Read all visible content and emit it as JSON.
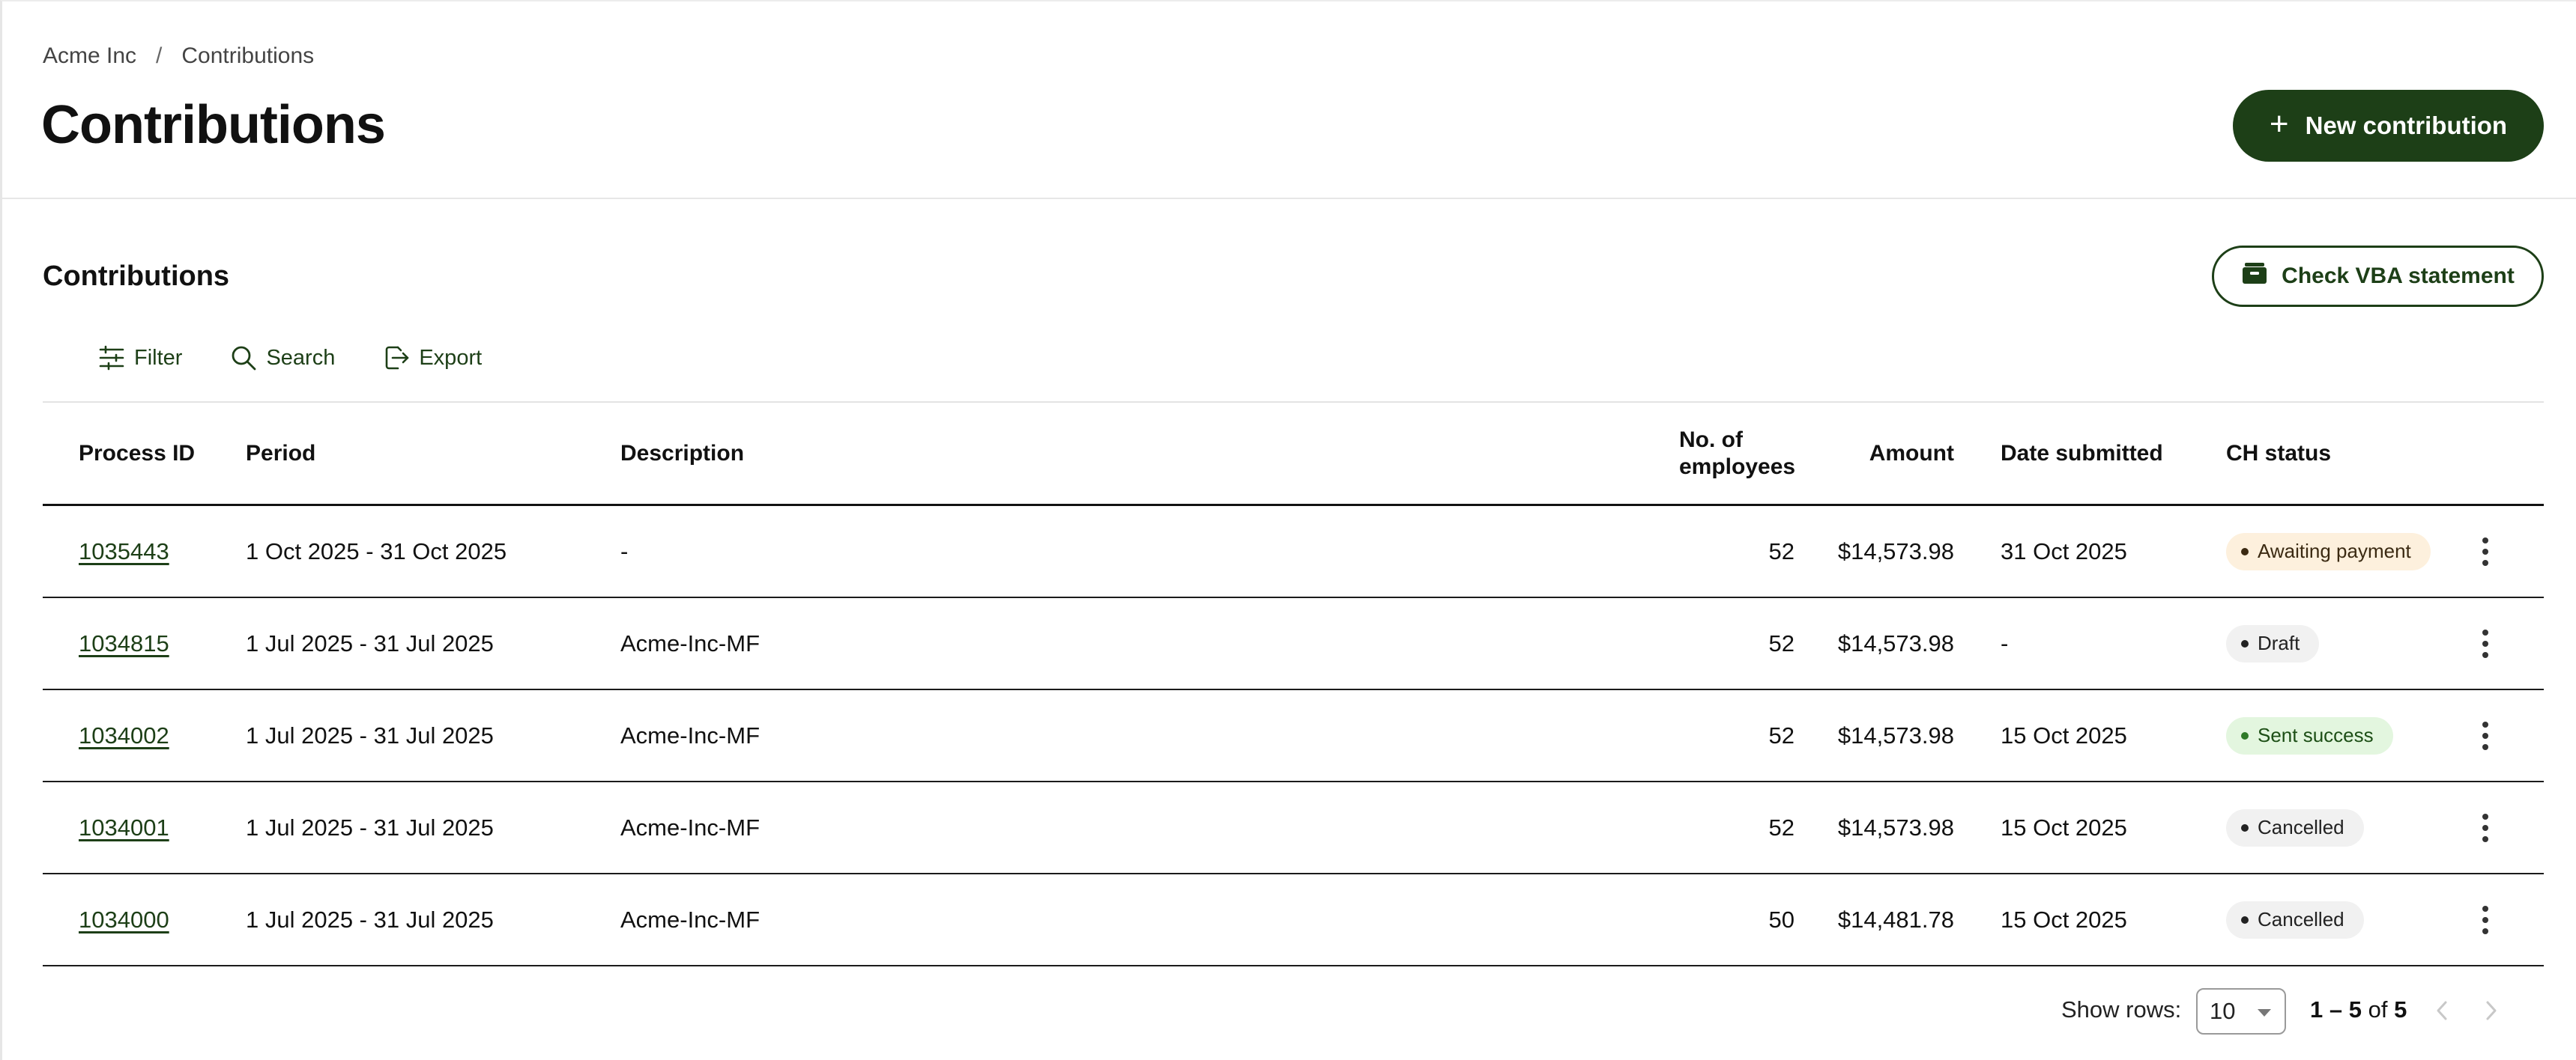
{
  "breadcrumb": {
    "root": "Acme Inc",
    "separator": "/",
    "current": "Contributions"
  },
  "page": {
    "title": "Contributions"
  },
  "header": {
    "new_contribution_label": "New contribution",
    "new_contribution_icon": "plus-icon"
  },
  "section": {
    "title": "Contributions",
    "vba_button_label": "Check VBA statement",
    "vba_icon": "wallet-icon"
  },
  "toolbar": {
    "filter_label": "Filter",
    "search_label": "Search",
    "export_label": "Export"
  },
  "table": {
    "columns": {
      "process_id": "Process ID",
      "period": "Period",
      "description": "Description",
      "employees_line1": "No. of",
      "employees_line2": "employees",
      "amount": "Amount",
      "date_submitted": "Date submitted",
      "ch_status": "CH status"
    },
    "rows": [
      {
        "id": "1035443",
        "period": "1 Oct 2025 - 31 Oct 2025",
        "description": "-",
        "employees": "52",
        "amount": "$14,573.98",
        "date": "31 Oct 2025",
        "status": "Awaiting payment",
        "status_kind": "awaiting"
      },
      {
        "id": "1034815",
        "period": "1 Jul 2025 - 31 Jul 2025",
        "description": "Acme-Inc-MF",
        "employees": "52",
        "amount": "$14,573.98",
        "date": "-",
        "status": "Draft",
        "status_kind": "draft"
      },
      {
        "id": "1034002",
        "period": "1 Jul 2025 - 31 Jul 2025",
        "description": "Acme-Inc-MF",
        "employees": "52",
        "amount": "$14,573.98",
        "date": "15 Oct 2025",
        "status": "Sent success",
        "status_kind": "success"
      },
      {
        "id": "1034001",
        "period": "1 Jul 2025 - 31 Jul 2025",
        "description": "Acme-Inc-MF",
        "employees": "52",
        "amount": "$14,573.98",
        "date": "15 Oct 2025",
        "status": "Cancelled",
        "status_kind": "cancelled"
      },
      {
        "id": "1034000",
        "period": "1 Jul 2025 - 31 Jul 2025",
        "description": "Acme-Inc-MF",
        "employees": "50",
        "amount": "$14,481.78",
        "date": "15 Oct 2025",
        "status": "Cancelled",
        "status_kind": "cancelled"
      }
    ]
  },
  "status_styles": {
    "awaiting": {
      "bg": "#fdf0dd",
      "dot": "#3b2a12",
      "fg": "#3b2a12"
    },
    "draft": {
      "bg": "#f1f1f1",
      "dot": "#222222",
      "fg": "#222222"
    },
    "success": {
      "bg": "#e3f6df",
      "dot": "#2f7a28",
      "fg": "#1d4f16"
    },
    "cancelled": {
      "bg": "#f1f1f1",
      "dot": "#222222",
      "fg": "#222222"
    }
  },
  "pagination": {
    "show_rows_label": "Show rows:",
    "rows_per_page": "10",
    "range": "1 – 5",
    "of_label": "of",
    "total": "5"
  },
  "colors": {
    "brand_green": "#1d3f17",
    "divider": "#e7e7e7",
    "row_border": "#1b1b1b"
  }
}
